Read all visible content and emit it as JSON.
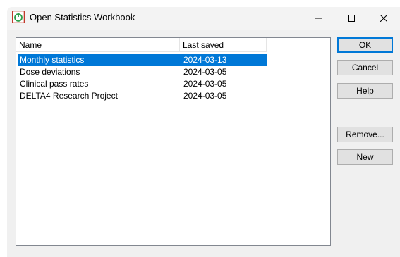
{
  "window": {
    "title": "Open Statistics Workbook"
  },
  "list": {
    "columns": [
      "Name",
      "Last saved"
    ],
    "rows": [
      {
        "name": "Monthly statistics",
        "last_saved": "2024-03-13",
        "selected": true
      },
      {
        "name": "Dose deviations",
        "last_saved": "2024-03-05",
        "selected": false
      },
      {
        "name": "Clinical pass rates",
        "last_saved": "2024-03-05",
        "selected": false
      },
      {
        "name": "DELTA4 Research Project",
        "last_saved": "2024-03-05",
        "selected": false
      }
    ]
  },
  "buttons": {
    "ok": "OK",
    "cancel": "Cancel",
    "help": "Help",
    "remove": "Remove...",
    "new": "New"
  },
  "icons": {
    "app": "app-logo-icon",
    "minimize": "minimize-icon",
    "maximize": "maximize-icon",
    "close": "close-icon"
  },
  "colors": {
    "selection": "#0078d7",
    "app_icon_red": "#c0392b",
    "app_icon_green": "#2e9d4a"
  }
}
